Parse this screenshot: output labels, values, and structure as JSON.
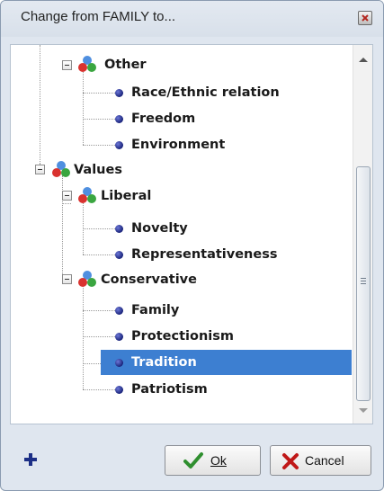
{
  "dialog": {
    "title": "Change from FAMILY to...",
    "close_icon": "close-icon"
  },
  "tree": {
    "nodes": [
      {
        "label": "Other",
        "kind": "group",
        "icon": "category-cluster-icon"
      },
      {
        "label": "Race/Ethnic relation",
        "kind": "leaf",
        "icon": "bullet-icon"
      },
      {
        "label": "Freedom",
        "kind": "leaf",
        "icon": "bullet-icon"
      },
      {
        "label": "Environment",
        "kind": "leaf",
        "icon": "bullet-icon"
      },
      {
        "label": "Values",
        "kind": "group",
        "icon": "category-cluster-icon"
      },
      {
        "label": "Liberal",
        "kind": "group",
        "icon": "category-cluster-icon"
      },
      {
        "label": "Novelty",
        "kind": "leaf",
        "icon": "bullet-icon"
      },
      {
        "label": "Representativeness",
        "kind": "leaf",
        "icon": "bullet-icon"
      },
      {
        "label": "Conservative",
        "kind": "group",
        "icon": "category-cluster-icon"
      },
      {
        "label": "Family",
        "kind": "leaf",
        "icon": "bullet-icon"
      },
      {
        "label": "Protectionism",
        "kind": "leaf",
        "icon": "bullet-icon"
      },
      {
        "label": "Tradition",
        "kind": "leaf",
        "icon": "bullet-icon",
        "selected": true
      },
      {
        "label": "Patriotism",
        "kind": "leaf",
        "icon": "bullet-icon"
      }
    ],
    "selection_color": "#3d7fd1"
  },
  "footer": {
    "add_icon": "plus-icon",
    "ok_label": "Ok",
    "cancel_label": "Cancel"
  }
}
